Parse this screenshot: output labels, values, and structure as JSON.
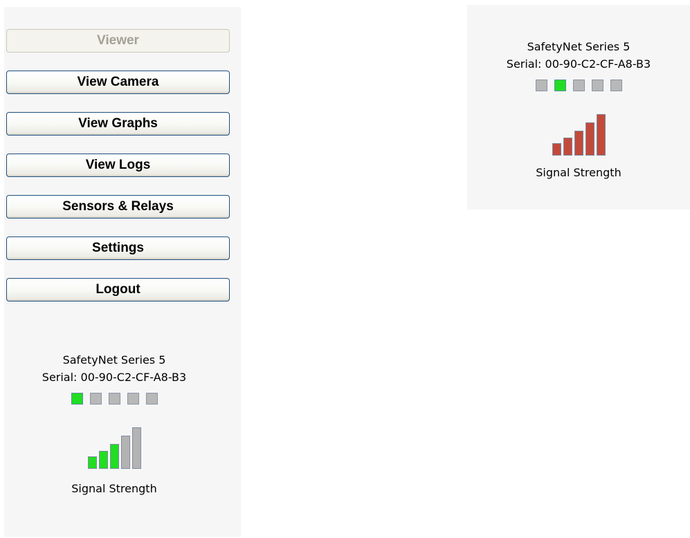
{
  "nav": {
    "buttons": [
      {
        "label": "Viewer",
        "enabled": false
      },
      {
        "label": "View Camera",
        "enabled": true
      },
      {
        "label": "View Graphs",
        "enabled": true
      },
      {
        "label": "View Logs",
        "enabled": true
      },
      {
        "label": "Sensors & Relays",
        "enabled": true
      },
      {
        "label": "Settings",
        "enabled": true
      },
      {
        "label": "Logout",
        "enabled": true
      }
    ]
  },
  "device_left": {
    "name": "SafetyNet Series 5",
    "serial": "Serial: 00-90-C2-CF-A8-B3",
    "indicators_total": 5,
    "active_indicator": 1,
    "signal_bars_total": 5,
    "signal_level": 3,
    "signal_color": "#22dd22",
    "signal_label": "Signal Strength"
  },
  "device_right": {
    "name": "SafetyNet Series 5",
    "serial": "Serial: 00-90-C2-CF-A8-B3",
    "indicators_total": 5,
    "active_indicator": 2,
    "signal_bars_total": 5,
    "signal_level": 5,
    "signal_color": "#c24a3a",
    "signal_label": "Signal Strength"
  },
  "colors": {
    "indicator_active": "#22dd22",
    "indicator_inactive": "#b8b8b8",
    "bar_inactive": "#b3b3b3",
    "button_border": "#1f4f7f"
  }
}
